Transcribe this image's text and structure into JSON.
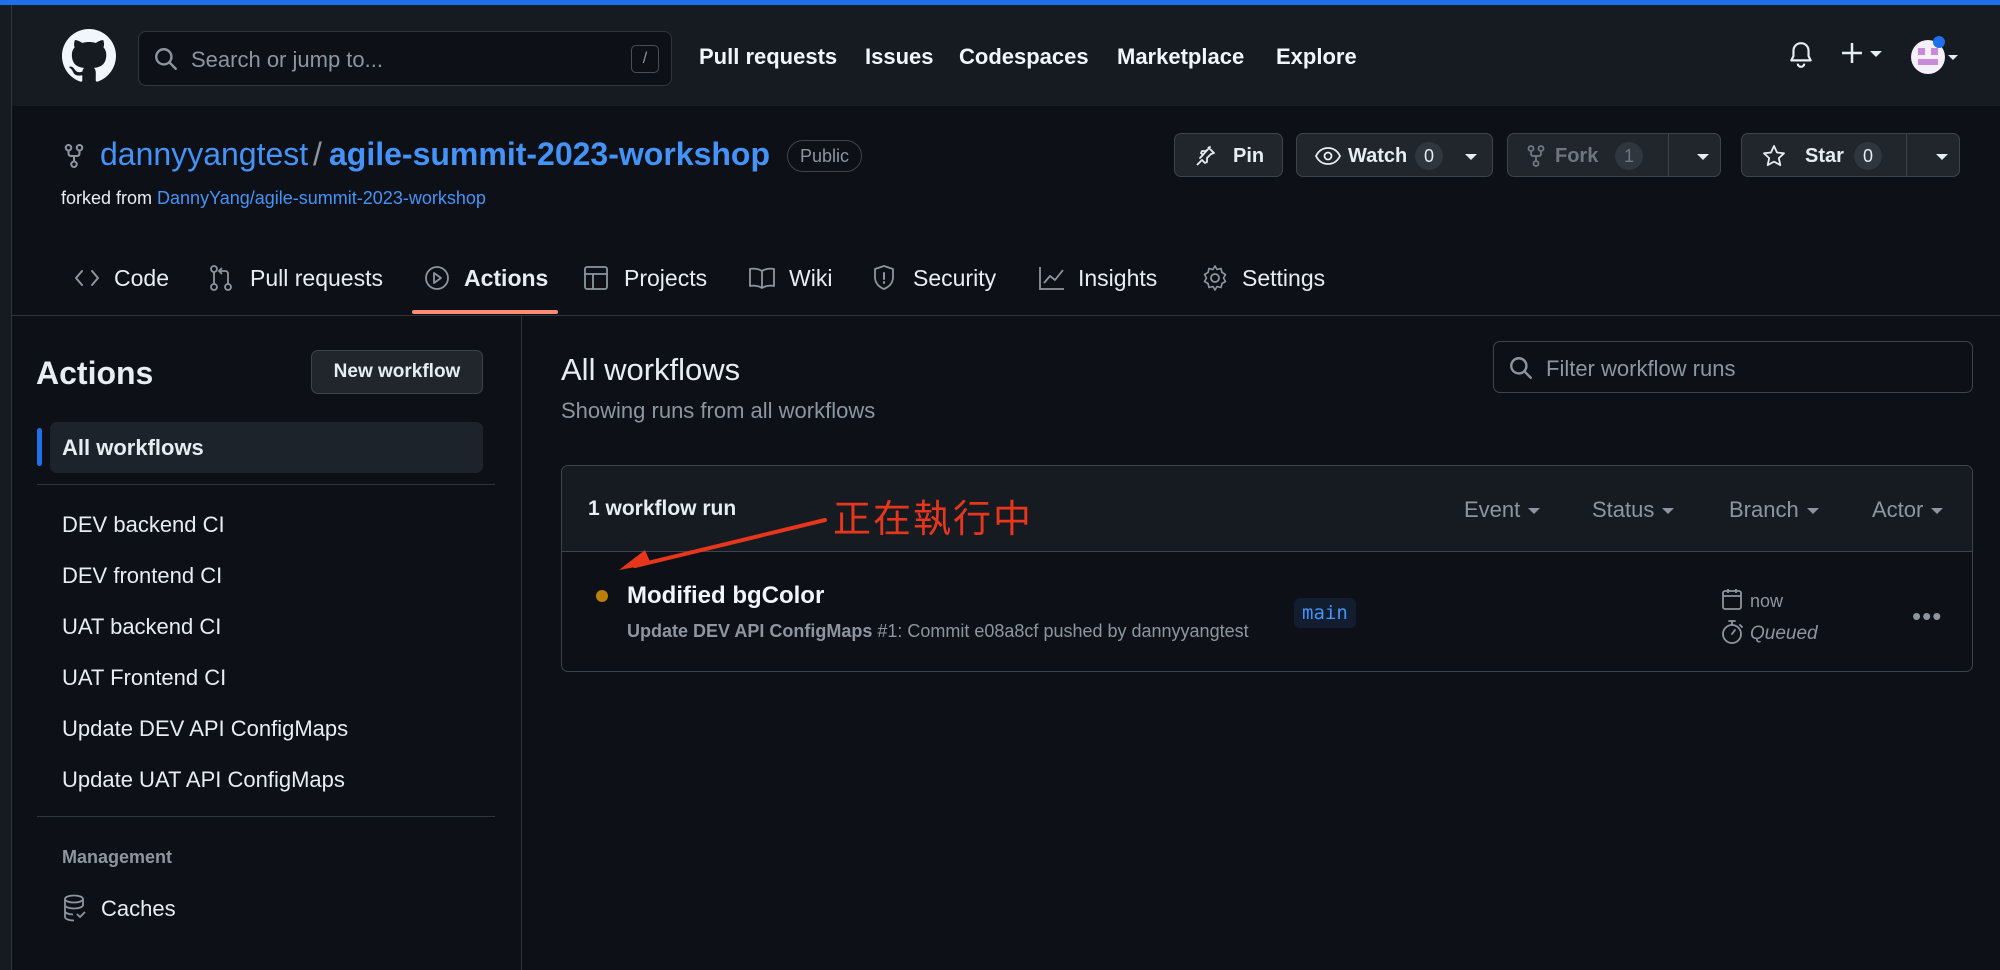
{
  "header": {
    "search_placeholder": "Search or jump to...",
    "search_shortcut": "/",
    "nav": [
      "Pull requests",
      "Issues",
      "Codespaces",
      "Marketplace",
      "Explore"
    ],
    "plus_label": "+"
  },
  "repo": {
    "owner": "dannyyangtest",
    "separator": "/",
    "name": "agile-summit-2023-workshop",
    "visibility": "Public",
    "forked_prefix": "forked from ",
    "forked_from": "DannyYang/agile-summit-2023-workshop",
    "pin_label": "Pin",
    "watch_label": "Watch",
    "watch_count": "0",
    "fork_label": "Fork",
    "fork_count": "1",
    "star_label": "Star",
    "star_count": "0"
  },
  "tabs": [
    "Code",
    "Pull requests",
    "Actions",
    "Projects",
    "Wiki",
    "Security",
    "Insights",
    "Settings"
  ],
  "sidebar": {
    "title": "Actions",
    "new_workflow": "New workflow",
    "all_workflows": "All workflows",
    "workflows": [
      "DEV backend CI",
      "DEV frontend CI",
      "UAT backend CI",
      "UAT Frontend CI",
      "Update DEV API ConfigMaps",
      "Update UAT API ConfigMaps"
    ],
    "management_heading": "Management",
    "caches": "Caches"
  },
  "main": {
    "title": "All workflows",
    "subtitle": "Showing runs from all workflows",
    "filter_placeholder": "Filter workflow runs",
    "run_count": "1 workflow run",
    "filters": [
      "Event",
      "Status",
      "Branch",
      "Actor"
    ],
    "run": {
      "title": "Modified bgColor",
      "workflow": "Update DEV API ConfigMaps",
      "meta": " #1: Commit e08a8cf pushed by dannyyangtest",
      "branch": "main",
      "time": "now",
      "status": "Queued",
      "status_color": "#bb8009"
    }
  },
  "annotation": {
    "text": "正在執行中",
    "color": "#e8361d"
  },
  "colors": {
    "accent": "#1f6feb",
    "link": "#4493f8",
    "tab_underline": "#fd8c73"
  }
}
